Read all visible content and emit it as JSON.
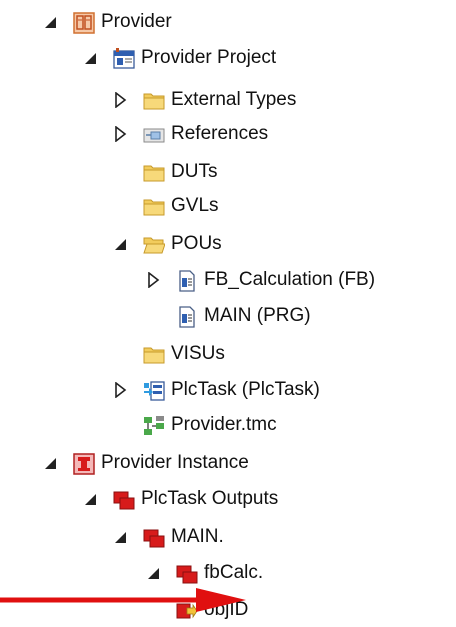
{
  "tree": {
    "nodes": [
      {
        "label": "Provider",
        "icon": "plc-project-icon",
        "expander": "expanded"
      },
      {
        "label": "Provider Project",
        "icon": "plc-project-file-icon",
        "expander": "expanded"
      },
      {
        "label": "External Types",
        "icon": "folder-icon",
        "expander": "collapsed"
      },
      {
        "label": "References",
        "icon": "references-icon",
        "expander": "collapsed"
      },
      {
        "label": "DUTs",
        "icon": "folder-icon",
        "expander": "none"
      },
      {
        "label": "GVLs",
        "icon": "folder-icon",
        "expander": "none"
      },
      {
        "label": "POUs",
        "icon": "folder-open-icon",
        "expander": "expanded"
      },
      {
        "label": "FB_Calculation (FB)",
        "icon": "pou-document-icon",
        "expander": "collapsed"
      },
      {
        "label": "MAIN (PRG)",
        "icon": "pou-document-icon",
        "expander": "none"
      },
      {
        "label": "VISUs",
        "icon": "folder-icon",
        "expander": "none"
      },
      {
        "label": "PlcTask (PlcTask)",
        "icon": "task-icon",
        "expander": "collapsed"
      },
      {
        "label": "Provider.tmc",
        "icon": "tmc-file-icon",
        "expander": "none"
      },
      {
        "label": "Provider Instance",
        "icon": "plc-instance-icon",
        "expander": "expanded"
      },
      {
        "label": "PlcTask Outputs",
        "icon": "outputs-icon",
        "expander": "expanded"
      },
      {
        "label": "MAIN.",
        "icon": "outputs-icon",
        "expander": "expanded"
      },
      {
        "label": "fbCalc.",
        "icon": "outputs-icon",
        "expander": "expanded"
      },
      {
        "label": "objID",
        "icon": "output-variable-icon",
        "expander": "none"
      }
    ]
  },
  "annotation": {
    "arrow_color": "#e01010"
  },
  "colors": {
    "folder": "#f2cc5c",
    "output_red": "#d71b1b",
    "expander": "#222222"
  }
}
